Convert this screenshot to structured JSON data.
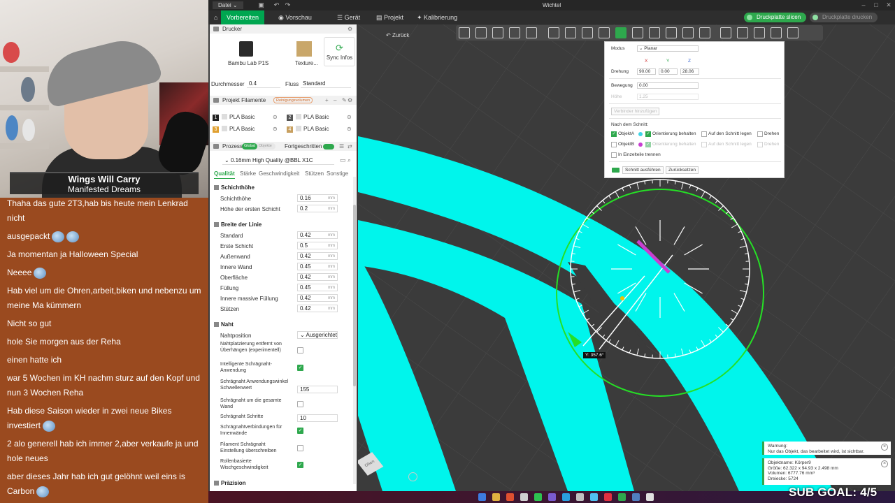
{
  "overlay": {
    "streamer_line1": "Wings Will Carry",
    "streamer_line2": "Manifested Dreams",
    "chat": [
      {
        "text": "Thaha das gute 2T3,hab bis heute mein Lenkrad nicht"
      },
      {
        "text": "ausgepackt",
        "emotes": 2
      },
      {
        "text": "Ja momentan ja Halloween Special"
      },
      {
        "text": "Neeee",
        "emotes": 1
      },
      {
        "text": "Hab viel um die Ohren,arbeit,biken und nebenzu um meine Ma kümmern"
      },
      {
        "text": "Nicht so gut"
      },
      {
        "text": "hole Sie morgen aus der Reha"
      },
      {
        "text": "einen hatte ich"
      },
      {
        "text": "war 5 Wochen im KH nachm sturz auf den Kopf und nun 3 Wochen Reha"
      },
      {
        "text": "Hab diese Saison wieder in zwei neue Bikes investiert",
        "emotes": 1
      },
      {
        "text": "2 alo generell hab ich immer 2,aber verkaufe ja und hole neues"
      },
      {
        "text": "aber dieses Jahr hab ich gut gelöhnt weil eins is Carbon",
        "emotes": 1
      }
    ],
    "sub_goal": "SUB GOAL: 4/5"
  },
  "app": {
    "menu": "Datei",
    "title": "Wichtel",
    "tabs": {
      "prepare": "Vorbereiten",
      "preview": "Vorschau",
      "device": "Gerät",
      "project": "Projekt",
      "calibration": "Kalibrierung"
    },
    "slice_button": "Druckplatte slicen",
    "print_button": "Druckplatte drucken",
    "back": "Zurück"
  },
  "panel": {
    "printer_header": "Drucker",
    "printer_name": "Bambu Lab P1S",
    "plate_name": "Texture...",
    "sync_label": "Sync Infos",
    "nozzle_label": "Durchmesser",
    "nozzle_value": "0.4",
    "flow_label": "Fluss",
    "flow_value": "Standard",
    "filaments_header": "Projekt Filamente",
    "flush_badge": "Reinigungsvolumen",
    "filaments": [
      {
        "num": "1",
        "name": "PLA Basic",
        "color": "#222222"
      },
      {
        "num": "2",
        "name": "PLA Basic",
        "color": "#555555"
      },
      {
        "num": "3",
        "name": "PLA Basic",
        "color": "#e0a030"
      },
      {
        "num": "4",
        "name": "PLA Basic",
        "color": "#c8a060"
      }
    ],
    "process_header": "Prozess",
    "process_global": "Global",
    "process_objects": "Objekte",
    "advanced_label": "Fortgeschritten",
    "preset": "0.16mm High Quality @BBL X1C",
    "subtabs": [
      "Qualität",
      "Stärke",
      "Geschwindigkeit",
      "Stützen",
      "Sonstige"
    ],
    "layer_group": "Schichthöhe",
    "layer_rows": [
      {
        "label": "Schichthöhe",
        "value": "0.16",
        "unit": "mm"
      },
      {
        "label": "Höhe der ersten Schicht",
        "value": "0.2",
        "unit": "mm"
      }
    ],
    "width_group": "Breite der Linie",
    "width_rows": [
      {
        "label": "Standard",
        "value": "0.42",
        "unit": "mm"
      },
      {
        "label": "Erste Schicht",
        "value": "0.5",
        "unit": "mm"
      },
      {
        "label": "Außenwand",
        "value": "0.42",
        "unit": "mm"
      },
      {
        "label": "Innere Wand",
        "value": "0.45",
        "unit": "mm"
      },
      {
        "label": "Oberfläche",
        "value": "0.42",
        "unit": "mm"
      },
      {
        "label": "Füllung",
        "value": "0.45",
        "unit": "mm"
      },
      {
        "label": "Innere massive Füllung",
        "value": "0.42",
        "unit": "mm"
      },
      {
        "label": "Stützen",
        "value": "0.42",
        "unit": "mm"
      }
    ],
    "seam_group": "Naht",
    "seam_position_label": "Nahtposition",
    "seam_position_value": "Ausgerichtet",
    "seam_rows": [
      {
        "label": "Nahtplatzierung entfernt von Überhängen (experimentell)",
        "checked": false
      },
      {
        "label": "Intelligente Schrägnaht-Anwendung",
        "checked": true
      },
      {
        "label": "Schrägnaht Anwendungswinkel Schwellenwert",
        "value": "155"
      },
      {
        "label": "Schrägnaht um die gesamte Wand",
        "checked": false
      },
      {
        "label": "Schrägnaht Schritte",
        "value": "10"
      },
      {
        "label": "Schrägnahtverbindungen für Innenwände",
        "checked": true
      },
      {
        "label": "Filament Schrägnaht Einstellung überschreiben",
        "checked": false
      },
      {
        "label": "Rollenbasierte Wischgeschwindigkeit",
        "checked": true
      }
    ],
    "precision_group": "Präzision"
  },
  "cut": {
    "mode_label": "Modus",
    "mode_value": "Planar",
    "axes": [
      "X",
      "Y",
      "Z"
    ],
    "rotation_label": "Drehung",
    "rotation": [
      "90.00",
      "0.00",
      "28.06"
    ],
    "move_label": "Bewegung",
    "move_value": "0.00",
    "height_label": "Höhe",
    "height_value": "1.25",
    "connector_btn": "Verbinder hinzufügen",
    "after_cut": "Nach dem Schnitt:",
    "objA": "ObjektA",
    "objB": "ObjektB",
    "keep_orient": "Orientierung behalten",
    "on_cut": "Auf den Schnitt legen",
    "flip": "Drehen",
    "split_parts": "In Einzelteile trennen",
    "run_btn": "Schnitt ausführen",
    "reset_btn": "Zurücksetzen",
    "colorA": "#3fd5e8",
    "colorB": "#c73fd1"
  },
  "viewport": {
    "tooltip": "Y: 357.6°",
    "cube_label": "Oben",
    "model_color": "#00f5ec"
  },
  "notifications": {
    "warning_title": "Warnung:",
    "warning_text": "Nur das Objekt, das bearbeitet wird, ist sichtbar.",
    "info_name": "Objektname: Körper9",
    "info_size": "Größe: 62.322 x 94.93 x 2.498 mm",
    "info_volume": "Volumen: 6777.76 mm³",
    "info_triangles": "Dreiecke: 5724"
  }
}
